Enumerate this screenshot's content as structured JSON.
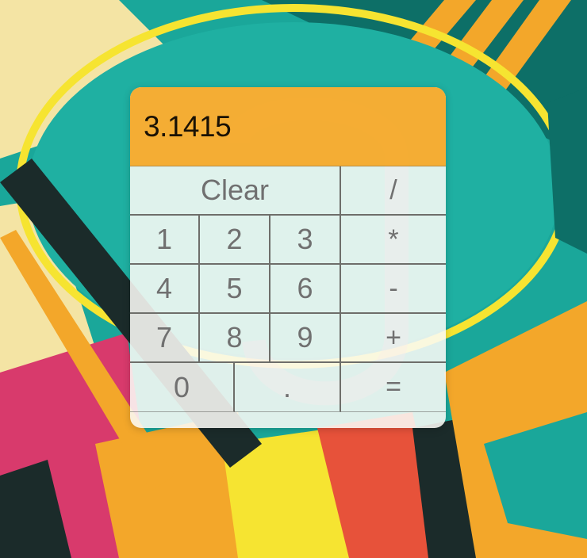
{
  "wallpaper": {
    "colors": {
      "teal": "#1aa79a",
      "dark_teal": "#0d6f67",
      "yellow": "#f6e431",
      "orange": "#f3a72a",
      "magenta": "#d83a6c",
      "cream": "#f4e4a4",
      "dark": "#1b2b2a"
    }
  },
  "calculator": {
    "display": {
      "value": "3.1415"
    },
    "keys": {
      "clear": "Clear",
      "divide": "/",
      "multiply": "*",
      "subtract": "-",
      "add": "+",
      "equals": "=",
      "dot": ".",
      "digits": {
        "d0": "0",
        "d1": "1",
        "d2": "2",
        "d3": "3",
        "d4": "4",
        "d5": "5",
        "d6": "6",
        "d7": "7",
        "d8": "8",
        "d9": "9"
      }
    },
    "colors": {
      "display_bg": "#f5a724",
      "display_text": "#1a1205",
      "key_text": "#707070",
      "grid_line": "#6e6e6a",
      "panel_bg": "#fafaf6"
    }
  }
}
